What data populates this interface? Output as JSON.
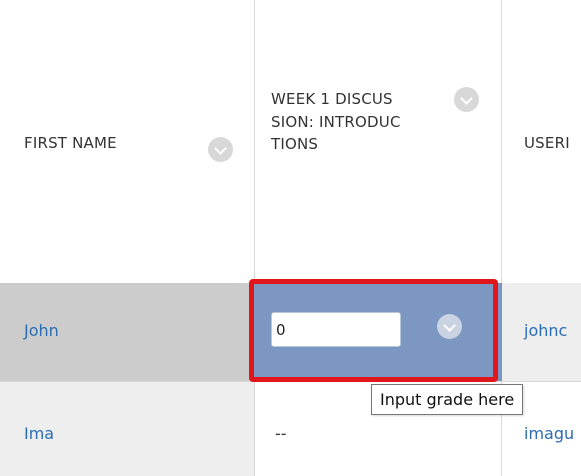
{
  "columns": {
    "first_name": {
      "label": "FIRST NAME"
    },
    "week1": {
      "label": "WEEK 1 DISCUSSION: INTRODUCTIONS"
    },
    "username": {
      "label": "USERI"
    }
  },
  "rows": [
    {
      "first_name": "John",
      "grade_value": "0",
      "username": "johnc"
    },
    {
      "first_name": "Ima",
      "grade_value": "--",
      "username": "imagu"
    }
  ],
  "tooltip": {
    "text": "Input grade here"
  },
  "colors": {
    "selected_row_bg": "#cccccc",
    "row_bg": "#eeeeee",
    "grade_cell_bg": "#7b97c2",
    "highlight_border": "#e0161b",
    "link": "#2a6db5"
  },
  "icons": {
    "header_menu": "chevron-down-icon",
    "grade_menu": "chevron-down-icon"
  }
}
